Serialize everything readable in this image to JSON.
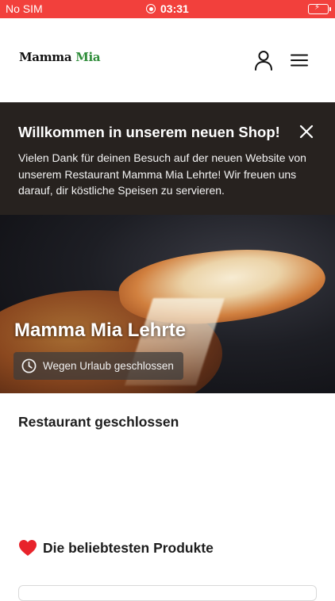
{
  "status_bar": {
    "carrier": "No SIM",
    "time": "03:31",
    "color": "#f2403c"
  },
  "header": {
    "logo_text_1": "Mamma",
    "logo_text_2": "Mia"
  },
  "welcome": {
    "title": "Willkommen in unserem neuen Shop!",
    "text": "Vielen Dank für deinen Besuch auf der neuen Website von unserem Restaurant Mamma Mia Lehrte! Wir freuen uns darauf, dir köstliche Speisen zu servieren.",
    "background": "#27221f"
  },
  "hero": {
    "title": "Mamma Mia Lehrte",
    "badge": "Wegen Urlaub geschlossen"
  },
  "sections": {
    "closed_title": "Restaurant geschlossen",
    "popular_title": "Die beliebtesten Produkte"
  },
  "icons": {
    "user": "user-icon",
    "menu": "hamburger-menu-icon",
    "close": "close-icon",
    "clock": "clock-icon",
    "heart": "heart-icon",
    "record": "record-icon",
    "battery": "battery-charging-icon"
  }
}
